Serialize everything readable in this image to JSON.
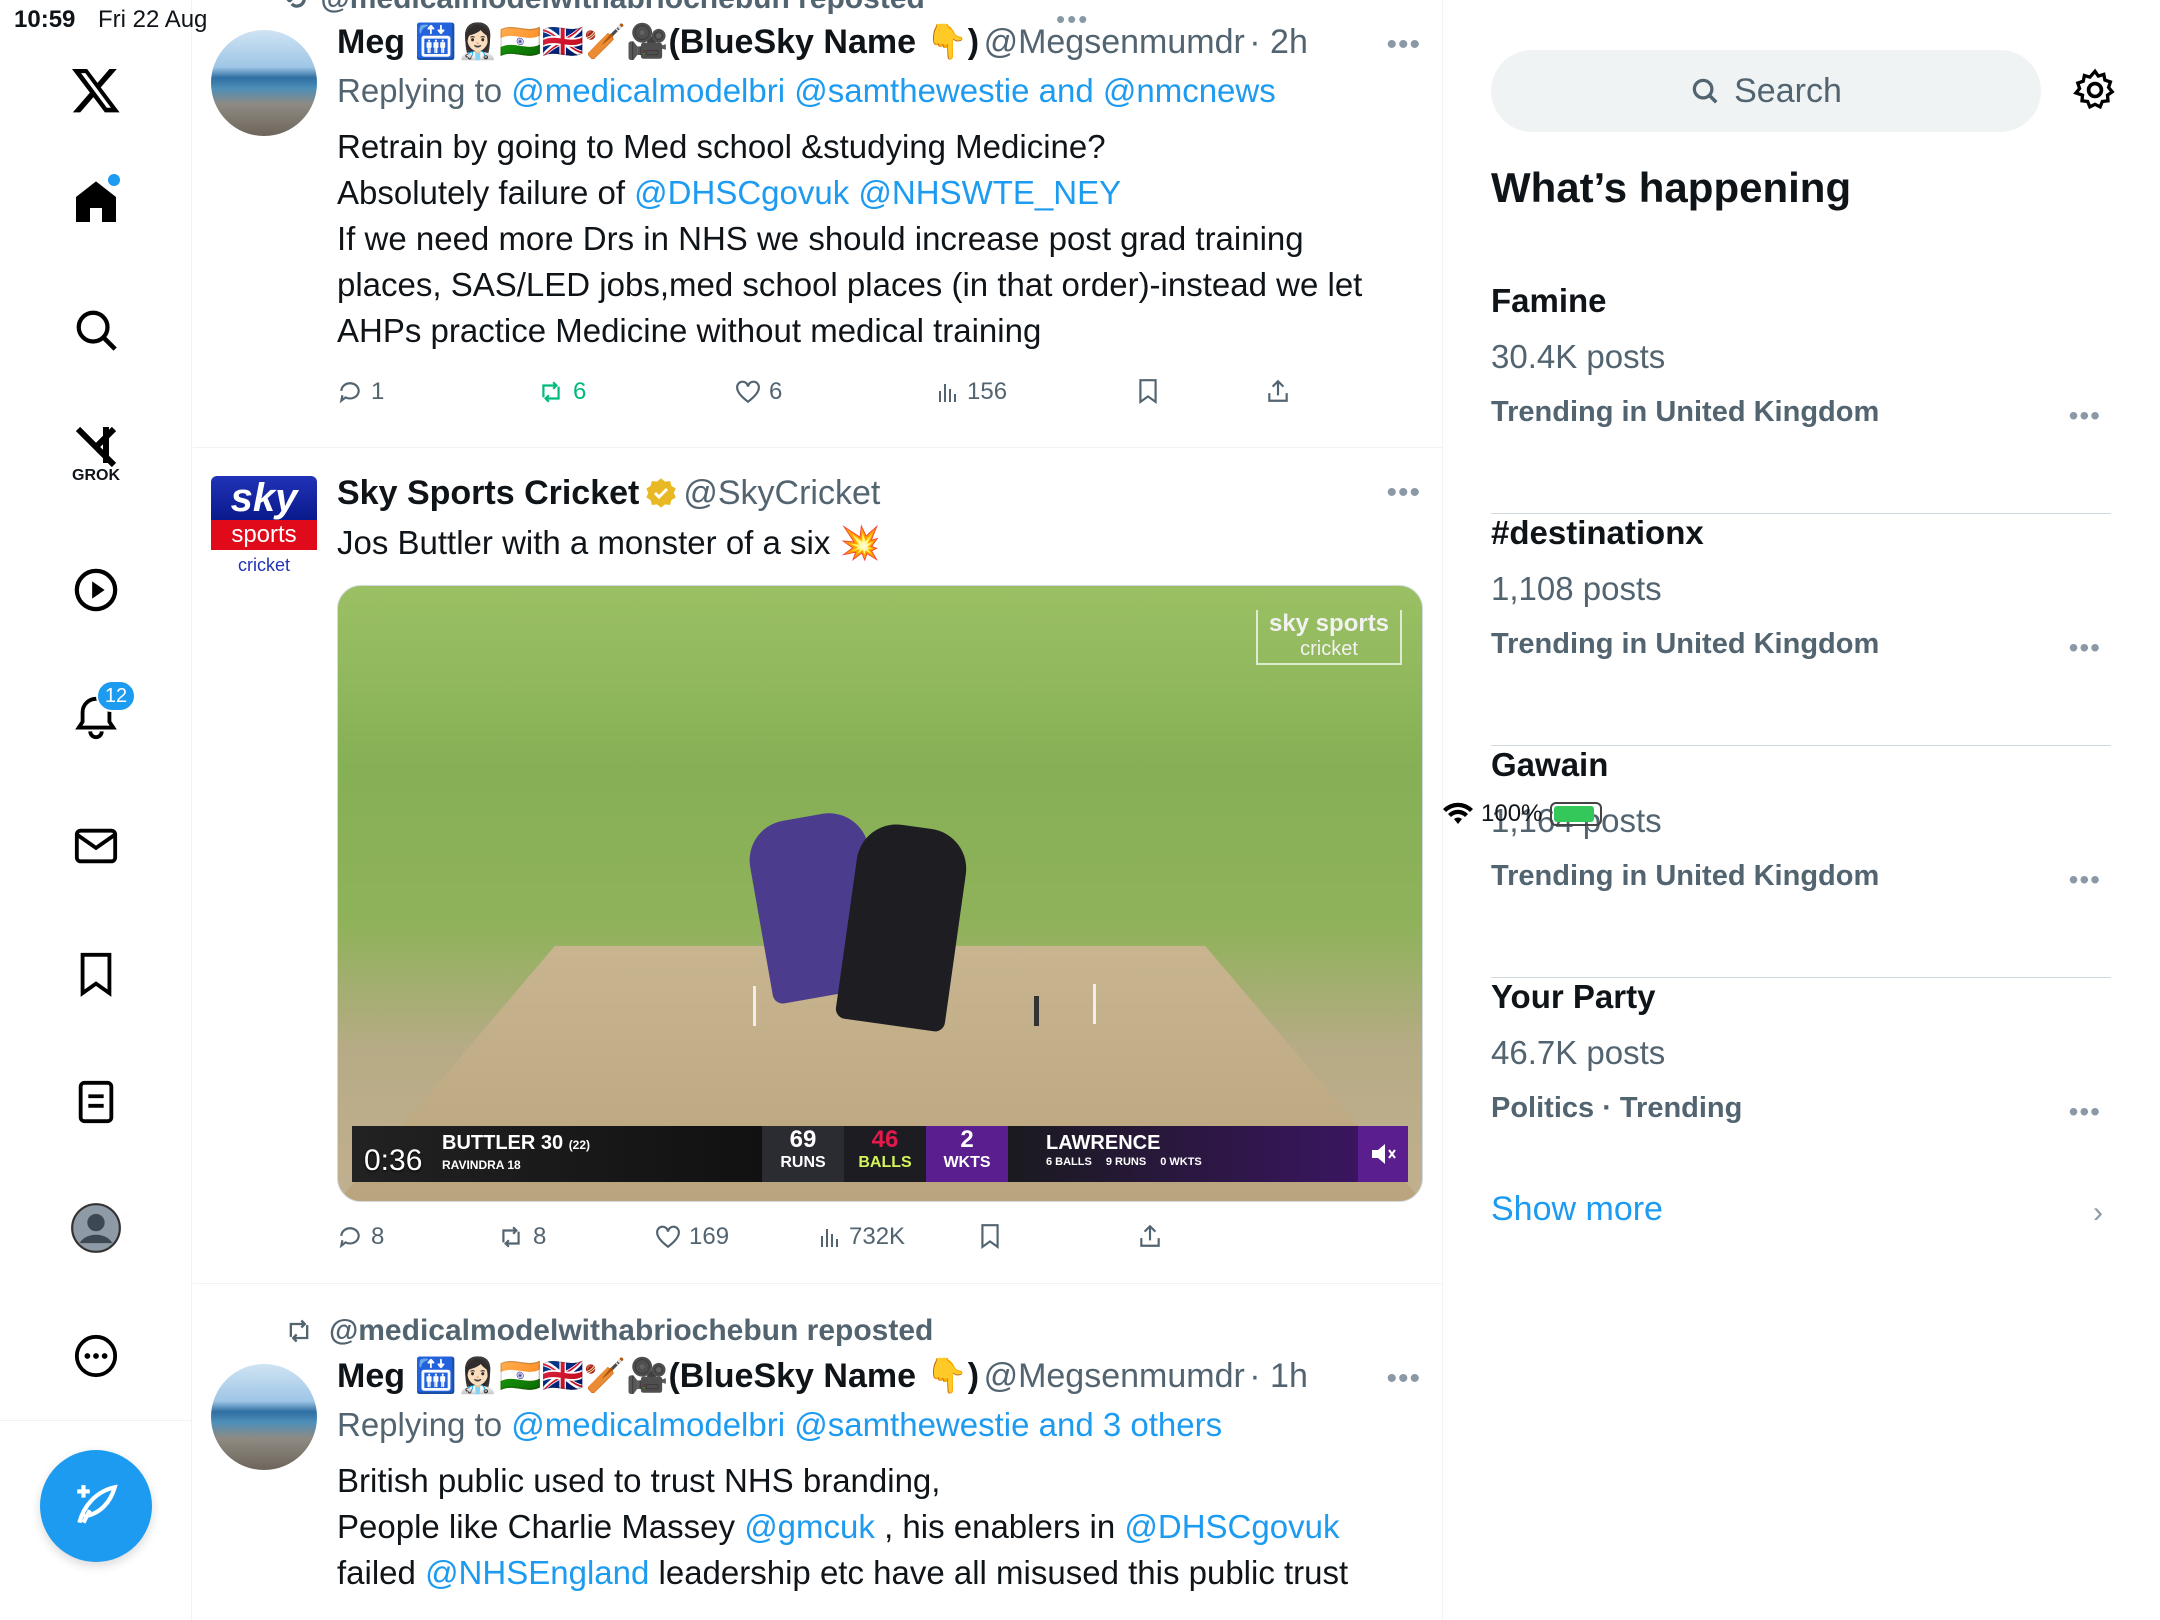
{
  "status_bar": {
    "time": "10:59",
    "date": "Fri 22 Aug",
    "battery": "100%",
    "top_dots": "•••"
  },
  "nav": {
    "grok_label": "GROK",
    "notifications_count": "12",
    "icons": [
      "x-logo-icon",
      "home-icon",
      "search-icon",
      "grok-icon",
      "video-icon",
      "bell-icon",
      "mail-icon",
      "bookmark-icon",
      "lists-icon",
      "profile-icon",
      "more-icon",
      "compose-icon"
    ]
  },
  "feed": {
    "top_cut_repost": "@medicalmodelwithabriochebun reposted",
    "tweet1": {
      "name": "Meg 🛗👩🏻‍⚕️🇮🇳🇬🇧🏏🎥(BlueSky Name 👇)",
      "handle": "@Megsenmumdr",
      "time": "· 2h",
      "replying_prefix": "Replying to",
      "replying_to": "@medicalmodelbri @samthewestie and @nmcnews",
      "line1": "Retrain by going to Med school &studying Medicine?",
      "line2_text": "Absolutely failure of",
      "line2_mention1": "@DHSCgovuk",
      "line2_mention2": "@NHSWTE_NEY",
      "line3": "If we need more Drs in NHS we should increase post grad training",
      "line4": "places, SAS/LED jobs,med school places (in that order)-instead we let",
      "line5": "AHPs practice Medicine without medical training",
      "replies": "1",
      "reposts": "6",
      "likes": "6",
      "views": "156"
    },
    "tweet2": {
      "name": "Sky Sports Cricket",
      "handle": "@SkyCricket",
      "text": "Jos Buttler with a monster of a six 💥",
      "logo_sky": "sky",
      "logo_sports": "sports",
      "logo_cricket": "cricket",
      "video": {
        "watermark_top": "sky sports",
        "watermark_bottom": "cricket",
        "duration": "0:36",
        "batter1": "BUTTLER 30",
        "batter1_balls": "(22)",
        "batter2": "RAVINDRA 18",
        "runs_value": "69",
        "runs_label": "RUNS",
        "balls_value": "46",
        "balls_label": "BALLS",
        "wkts_value": "2",
        "wkts_label": "WKTS",
        "bowler": "LAWRENCE",
        "bowler_balls": "6 BALLS",
        "bowler_runs": "9 RUNS",
        "bowler_wkts": "0 WKTS"
      },
      "replies": "8",
      "reposts": "8",
      "likes": "169",
      "views": "732K"
    },
    "tweet3": {
      "repost_label": "@medicalmodelwithabriochebun reposted",
      "name": "Meg 🛗👩🏻‍⚕️🇮🇳🇬🇧🏏🎥(BlueSky Name 👇)",
      "handle": "@Megsenmumdr",
      "time": "· 1h",
      "replying_prefix": "Replying to",
      "replying_to": "@medicalmodelbri @samthewestie and 3 others",
      "line1": "British public used to trust NHS branding,",
      "line2_a": "People like Charlie Massey",
      "line2_m1": "@gmcuk",
      "line2_b": ", his enablers in",
      "line2_m2": "@DHSCgovuk",
      "line3_a": "failed",
      "line3_m1": "@NHSEngland",
      "line3_b": "leadership etc have all misused this public trust"
    }
  },
  "sidebar": {
    "search_placeholder": "Search",
    "whats_happening": "What’s happening",
    "trends": [
      {
        "name": "Famine",
        "posts": "30.4K posts",
        "context": "Trending in United Kingdom"
      },
      {
        "name": "#destinationx",
        "posts": "1,108 posts",
        "context": "Trending in United Kingdom"
      },
      {
        "name": "Gawain",
        "posts": "1,164 posts",
        "context": "Trending in United Kingdom"
      },
      {
        "name": "Your Party",
        "posts": "46.7K posts",
        "context": "Politics · Trending"
      }
    ],
    "show_more": "Show more"
  },
  "colors": {
    "accent": "#1d9bf0",
    "text": "#0f1419",
    "muted": "#536471",
    "repost_green": "#00ba7c"
  }
}
